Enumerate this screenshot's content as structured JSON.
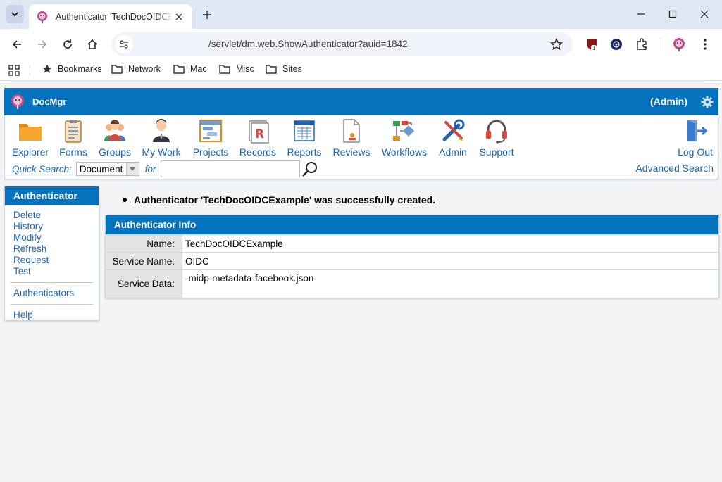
{
  "browser": {
    "tab_title": "Authenticator 'TechDocOIDCExample' - DocMgr",
    "url": "/servlet/dm.web.ShowAuthenticator?auid=1842",
    "extension_badge": "1",
    "bookmarks": [
      "Bookmarks",
      "Network",
      "Mac",
      "Misc",
      "Sites"
    ]
  },
  "app": {
    "name": "DocMgr",
    "user_label": "(Admin)",
    "brand_color": "#0572bd",
    "link_color": "#1d63b0",
    "tools": [
      {
        "label": "Explorer",
        "icon": "folder-icon"
      },
      {
        "label": "Forms",
        "icon": "clipboard-icon"
      },
      {
        "label": "Groups",
        "icon": "group-icon"
      },
      {
        "label": "My Work",
        "icon": "person-icon"
      },
      {
        "label": "Projects",
        "icon": "project-board-icon"
      },
      {
        "label": "Records",
        "icon": "records-icon"
      },
      {
        "label": "Reports",
        "icon": "report-icon"
      },
      {
        "label": "Reviews",
        "icon": "review-document-icon"
      },
      {
        "label": "Workflows",
        "icon": "workflow-icon"
      },
      {
        "label": "Admin",
        "icon": "tools-icon"
      },
      {
        "label": "Support",
        "icon": "headset-icon"
      }
    ],
    "logout_label": "Log Out",
    "quick_search": {
      "label": "Quick Search:",
      "selected_type": "Document",
      "for_label": "for",
      "value": "",
      "advanced_label": "Advanced Search"
    }
  },
  "sidebar": {
    "title": "Authenticator",
    "actions": [
      "Delete",
      "History",
      "Modify",
      "Refresh",
      "Request",
      "Test"
    ],
    "list_link": "Authenticators",
    "help": "Help"
  },
  "main": {
    "message": "Authenticator 'TechDocOIDCExample' was successfully created.",
    "panel_title": "Authenticator Info",
    "fields": [
      {
        "label": "Name:",
        "value": "TechDocOIDCExample"
      },
      {
        "label": "Service Name:",
        "value": "OIDC"
      },
      {
        "label": "Service Data:",
        "value": "-midp-metadata-facebook.json"
      }
    ]
  }
}
